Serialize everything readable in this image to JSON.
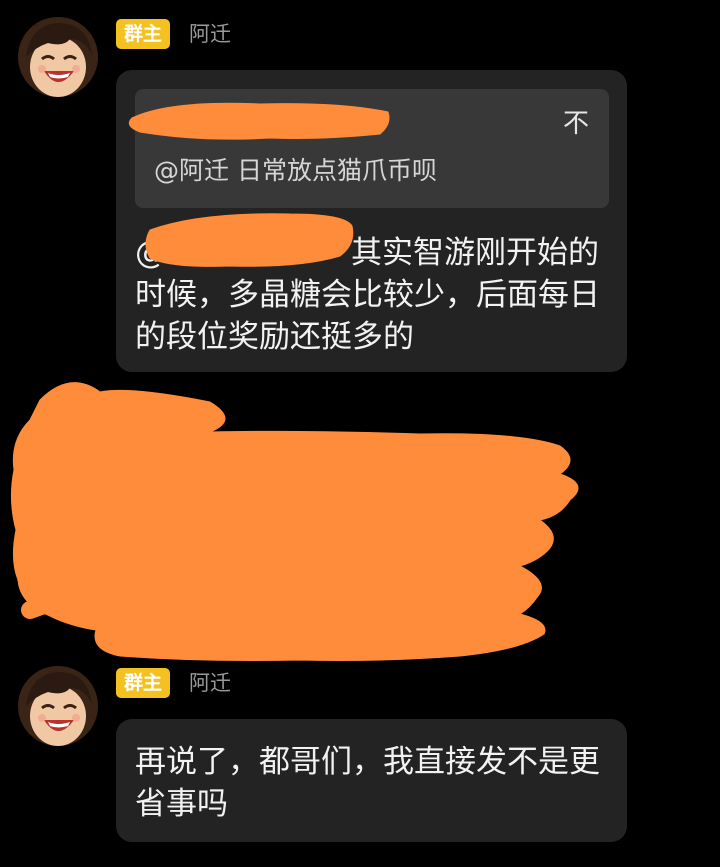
{
  "messages": [
    {
      "badge": "群主",
      "sender": "阿迁",
      "quote": {
        "collapse_icon": "不",
        "text": "@阿迁 日常放点猫爪币呗"
      },
      "mention": "@",
      "text": "其实智游刚开始的时候，多晶糖会比较少，后面每日的段位奖励还挺多的"
    },
    {
      "badge": "群主",
      "sender": "阿迁",
      "text": "再说了，都哥们，我直接发不是更省事吗"
    }
  ],
  "colors": {
    "background": "#000000",
    "bubble": "#232323",
    "quote_box": "#383838",
    "badge": "#f3c221",
    "redaction": "#ff8c3a",
    "sender_name": "#9a9a9a"
  },
  "icons": [
    "avatar-icon",
    "collapse-icon"
  ]
}
